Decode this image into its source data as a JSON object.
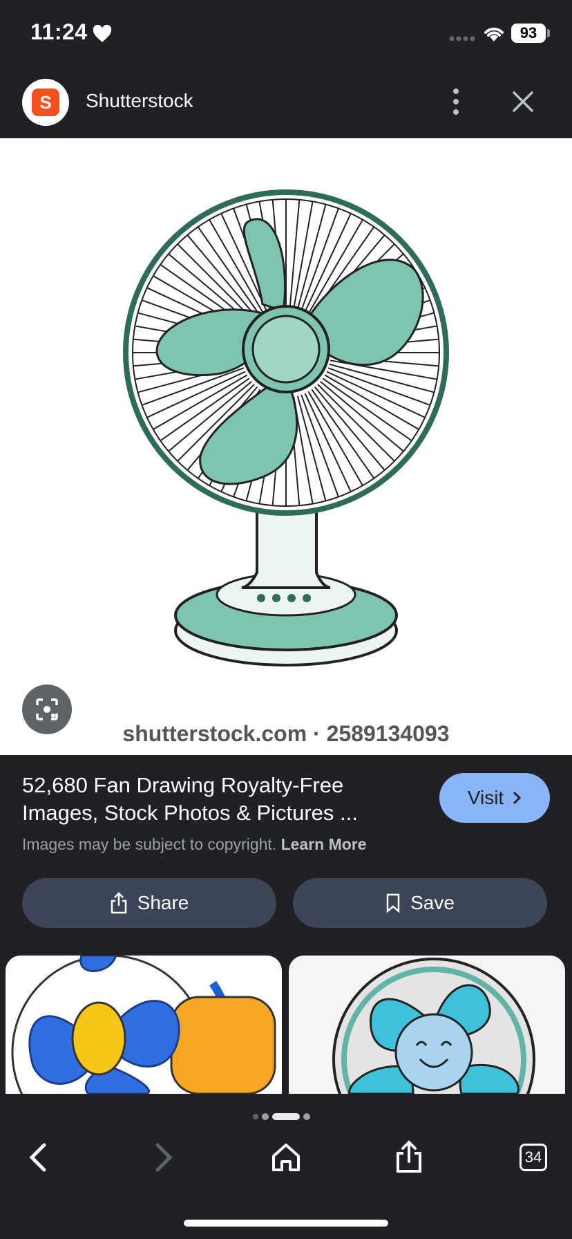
{
  "status": {
    "time": "11:24",
    "battery": "93"
  },
  "header": {
    "site_name": "Shutterstock",
    "logo_glyph": "S"
  },
  "image": {
    "watermark": "shutterstock.com · 2589134093",
    "colors": {
      "fan_green": "#7fc4b0",
      "fan_outline": "#2e6b5a",
      "background": "#ffffff"
    }
  },
  "result": {
    "title": "52,680 Fan Drawing Royalty-Free Images, Stock Photos & Pictures ...",
    "visit_label": "Visit",
    "copyright_text": "Images may be subject to copyright.",
    "learn_more": "Learn More",
    "share_label": "Share",
    "save_label": "Save"
  },
  "toolbar": {
    "tab_count": "34"
  },
  "colors": {
    "background": "#202124",
    "accent": "#8ab4f8",
    "button_bg": "#3c4556"
  }
}
